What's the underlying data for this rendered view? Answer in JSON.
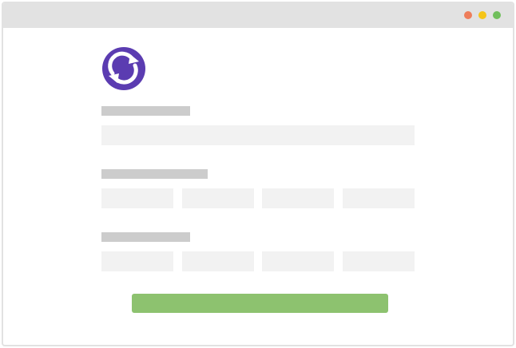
{
  "window": {
    "controls": [
      {
        "name": "close",
        "color": "#ee7d5a"
      },
      {
        "name": "minimize",
        "color": "#f5c518"
      },
      {
        "name": "maximize",
        "color": "#70bf5c"
      }
    ]
  },
  "brand": {
    "icon": "circular-arrows-logo-icon",
    "color": "#5b3cb1"
  },
  "form": {
    "placeholder_bar_color": "#cccccc",
    "field_color": "#f2f2f2",
    "submit_color": "#8dc26f"
  }
}
